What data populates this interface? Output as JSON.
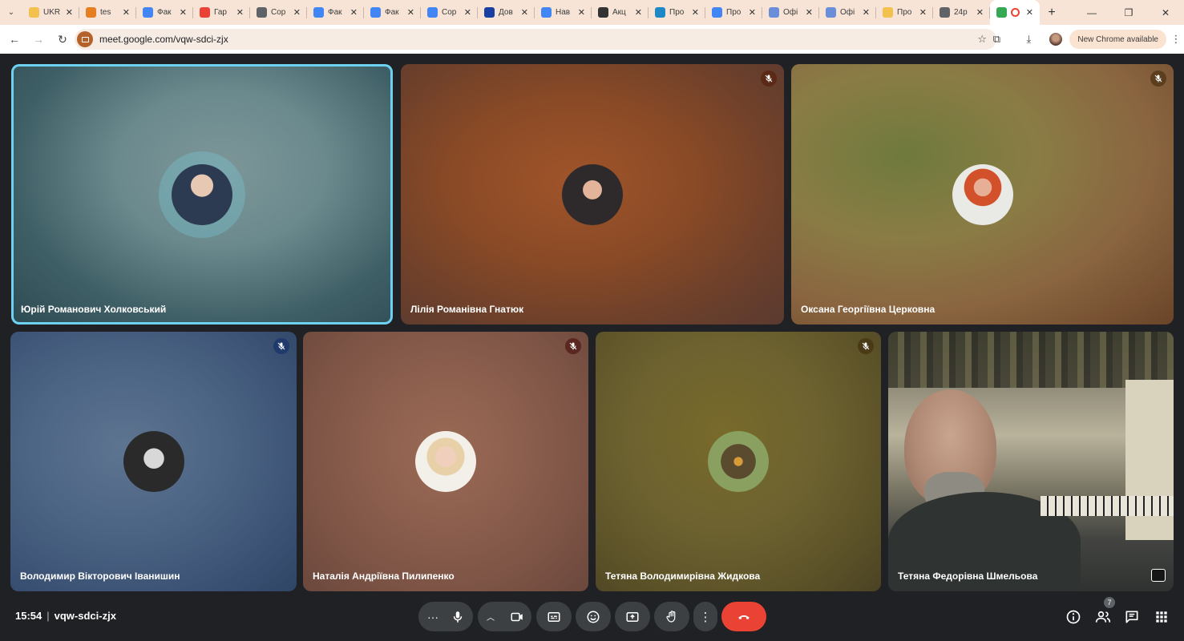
{
  "browser": {
    "tabs": [
      {
        "label": "UKR",
        "color": "#f2c14e"
      },
      {
        "label": "tes",
        "color": "#e67e22"
      },
      {
        "label": "Фак",
        "color": "#4285f4"
      },
      {
        "label": "Гар",
        "color": "#ea4335"
      },
      {
        "label": "Сор",
        "color": "#5f6368"
      },
      {
        "label": "Фак",
        "color": "#4285f4"
      },
      {
        "label": "Фак",
        "color": "#4285f4"
      },
      {
        "label": "Сор",
        "color": "#4285f4"
      },
      {
        "label": "Дов",
        "color": "#1a3fa3"
      },
      {
        "label": "Нав",
        "color": "#4285f4"
      },
      {
        "label": "Акц",
        "color": "#333333"
      },
      {
        "label": "Про",
        "color": "#1e88c7"
      },
      {
        "label": "Про",
        "color": "#4285f4"
      },
      {
        "label": "Офі",
        "color": "#6a8fd8"
      },
      {
        "label": "Офі",
        "color": "#6a8fd8"
      },
      {
        "label": "Про",
        "color": "#f2c14e"
      },
      {
        "label": "24р",
        "color": "#5f6368"
      }
    ],
    "url": "meet.google.com/vqw-sdci-zjx",
    "update_label": "New Chrome available"
  },
  "participants": [
    {
      "name": "Юрій Романович Холковський",
      "bg": "radial-gradient(ellipse at 55% 40%, #7d9698 0%, #6b8a8e 35%, #3f5f66 70%, #2d4a52 100%)",
      "avatar": "radial-gradient(circle at 50% 35%, #e7c8b2 0 22%, #2c3a52 23% 100%)",
      "speaking": true,
      "muted": false
    },
    {
      "name": "Лілія Романівна Гнатюк",
      "bg": "radial-gradient(ellipse at 45% 45%, #a0542a 0%, #8a4a26 40%, #6b3f2b 75%, #5a3a30 100%)",
      "avatar": "radial-gradient(circle at 50% 42%, #e3b49a 0 20%, #2e2a2c 21% 100%)",
      "speaking": false,
      "muted": true,
      "mute_color": "#5a2a16"
    },
    {
      "name": "Оксана Георгіївна Церковна",
      "bg": "radial-gradient(ellipse at 30% 35%, #6f7a3c 0%, #8a7c45 35%, #8a6540 65%, #6a4428 100%)",
      "avatar": "radial-gradient(circle at 50% 38%, #e7b096 0 18%, #d3512a 19% 38%, #e9e9e6 39% 100%)",
      "speaking": false,
      "muted": true,
      "mute_color": "#5a3e1e"
    },
    {
      "name": "Володимир Вікторович Іванишин",
      "bg": "radial-gradient(ellipse at 40% 45%, #5d7590 0%, #4d6585 40%, #3b5274 75%, #2f4566 100%)",
      "avatar": "radial-gradient(circle at 50% 45%, #d8d8d8 0 22%, #2a2a2a 23% 100%)",
      "speaking": false,
      "muted": true,
      "mute_color": "#1f3a6b"
    },
    {
      "name": "Наталія Андріївна Пилипенко",
      "bg": "radial-gradient(ellipse at 50% 45%, #9a6a55 0%, #8b5e4d 40%, #7a5244 75%, #6a473c 100%)",
      "avatar": "radial-gradient(circle at 50% 42%, #f0d0bd 0 22%, #e8d1a8 23% 40%, #f3efe9 41% 100%)",
      "speaking": false,
      "muted": true,
      "mute_color": "#5a2820"
    },
    {
      "name": "Тетяна Володимирівна Жидкова",
      "bg": "radial-gradient(ellipse at 45% 40%, #786a2a 0%, #6e6330 40%, #5c5228 75%, #4b4224 100%)",
      "avatar": "radial-gradient(circle at 50% 50%, #d99a3a 0 10%, #5a4a2e 11% 40%, #8aa060 41% 100%)",
      "speaking": false,
      "muted": true,
      "mute_color": "#4a3a16"
    },
    {
      "name": "Тетяна Федорівна Шмельова",
      "bg": "linear-gradient(180deg, #5a5e4a 0%, #8a8573 18%, #b9b39c 40%, #7c7866 60%, #434441 80%, #2f3230 100%)",
      "avatar": "",
      "speaking": false,
      "muted": false,
      "video": true
    }
  ],
  "bottom_bar": {
    "time": "15:54",
    "meeting_code": "vqw-sdci-zjx",
    "participant_count": "7"
  }
}
